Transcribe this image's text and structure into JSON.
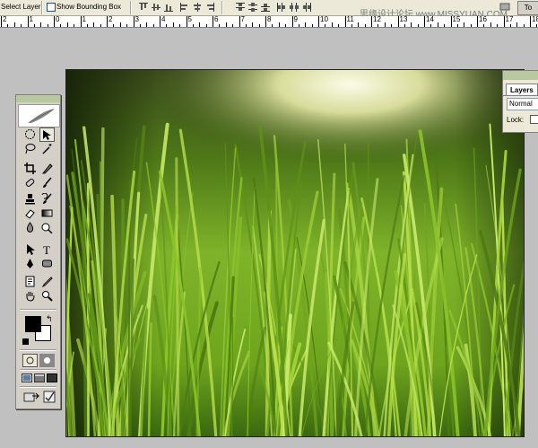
{
  "options_bar": {
    "select_layer_label": "Select Layer",
    "show_bounding_box_label": "Show Bounding Box",
    "watermark": "思缘设计论坛 www.MISSYUAN.COM",
    "right_button_label": "To",
    "align_icons": [
      "align-top-icon",
      "align-vcenter-icon",
      "align-bottom-icon",
      "align-left-icon",
      "align-hcenter-icon",
      "align-right-icon",
      "distribute-top-icon",
      "distribute-vcenter-icon",
      "distribute-bottom-icon",
      "distribute-left-icon",
      "distribute-hcenter-icon",
      "distribute-right-icon"
    ]
  },
  "ruler": {
    "labels": [
      "2",
      "1",
      "0",
      "1",
      "2",
      "3",
      "4",
      "5",
      "6",
      "7",
      "8",
      "9",
      "10",
      "11",
      "12",
      "13",
      "14",
      "15",
      "16",
      "17",
      "18"
    ]
  },
  "canvas": {
    "image_description_colors": {
      "grass": "#7fb52a",
      "bokeh": "#f2f0d8",
      "shadow": "#1a2a08"
    }
  },
  "toolbox": {
    "tools": [
      "marquee-icon",
      "move-icon",
      "lasso-icon",
      "magic-wand-icon",
      "crop-icon",
      "slice-icon",
      "healing-brush-icon",
      "brush-icon",
      "clone-stamp-icon",
      "history-brush-icon",
      "eraser-icon",
      "gradient-icon",
      "blur-icon",
      "dodge-icon",
      "path-select-icon",
      "type-icon",
      "pen-icon",
      "shape-icon",
      "notes-icon",
      "eyedropper-icon",
      "hand-icon",
      "zoom-icon"
    ],
    "foreground_color": "#000000",
    "background_color": "#ffffff"
  },
  "layers_panel": {
    "tab_label": "Layers",
    "blend_mode": "Normal",
    "lock_label": "Lock:"
  }
}
